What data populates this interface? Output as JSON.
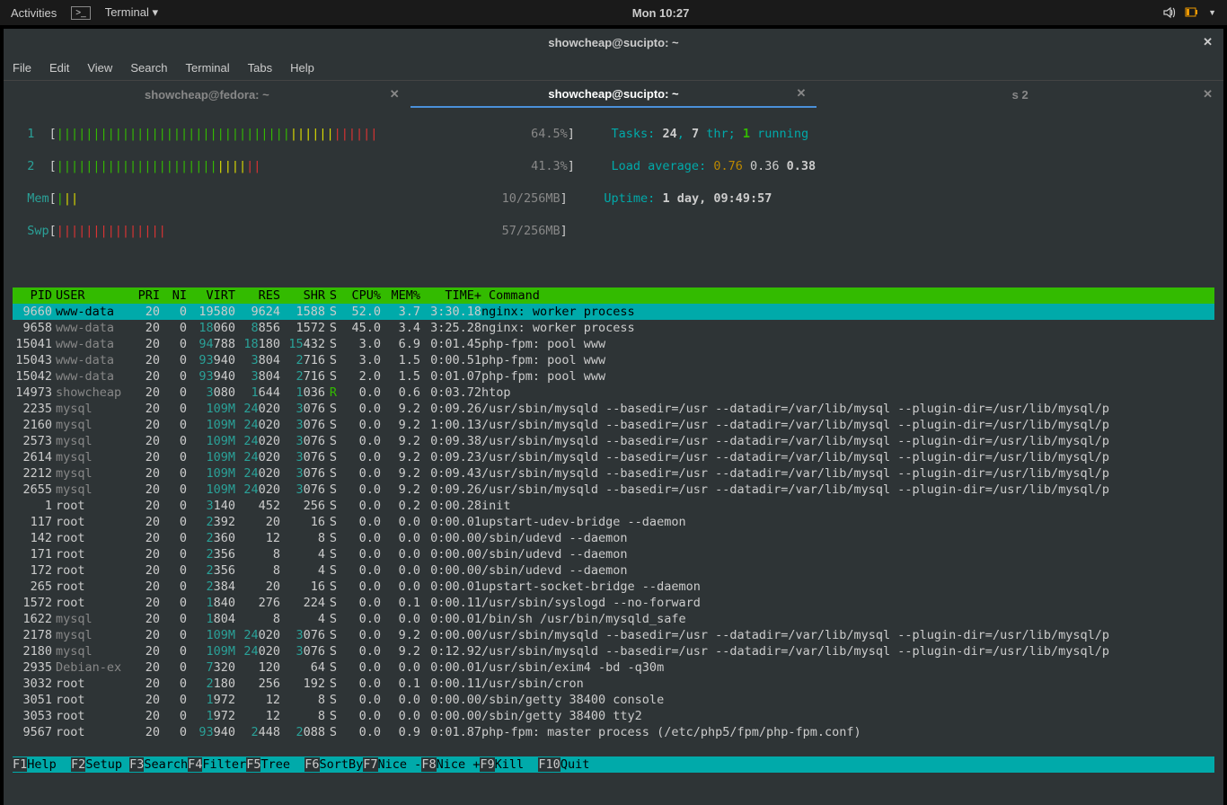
{
  "topbar": {
    "activities": "Activities",
    "terminal": "Terminal ▾",
    "clock": "Mon 10:27"
  },
  "titlebar": {
    "title": "showcheap@sucipto: ~"
  },
  "menubar": [
    "File",
    "Edit",
    "View",
    "Search",
    "Terminal",
    "Tabs",
    "Help"
  ],
  "tabs": [
    {
      "label": "showcheap@fedora: ~",
      "active": false
    },
    {
      "label": "showcheap@sucipto: ~",
      "active": true
    },
    {
      "label": "s                          2",
      "active": false
    }
  ],
  "meters": {
    "cpu1": {
      "label": "1",
      "pct": "64.5%"
    },
    "cpu2": {
      "label": "2",
      "pct": "41.3%"
    },
    "mem": {
      "label": "Mem",
      "val": "10/256MB"
    },
    "swp": {
      "label": "Swp",
      "val": "57/256MB"
    }
  },
  "stats": {
    "tasks_label": "Tasks: ",
    "tasks_n": "24",
    "tasks_comma": ", ",
    "thr_n": "7",
    "thr": " thr; ",
    "running_n": "1",
    "running": " running",
    "load_label": "Load average: ",
    "load1": "0.76",
    "load2": "0.36",
    "load3": "0.38",
    "uptime_label": "Uptime: ",
    "uptime": "1 day, 09:49:57"
  },
  "header": [
    "PID",
    "USER",
    "PRI",
    "NI",
    "VIRT",
    "RES",
    "SHR",
    "S",
    "CPU%",
    "MEM%",
    "TIME+",
    "Command"
  ],
  "processes": [
    {
      "pid": "9660",
      "user": "www-data",
      "pri": "20",
      "ni": "0",
      "virt": "19580",
      "res": "9624",
      "shr": "1588",
      "s": "S",
      "cpu": "52.0",
      "mem": "3.7",
      "time": "3:30.18",
      "cmd": "nginx: worker process",
      "sel": true
    },
    {
      "pid": "9658",
      "user": "www-data",
      "pri": "20",
      "ni": "0",
      "virt": "18060",
      "vh": "18",
      "res": "8856",
      "rh": "8",
      "shr": "1572",
      "s": "S",
      "cpu": "45.0",
      "mem": "3.4",
      "time": "3:25.28",
      "cmd": "nginx: worker process"
    },
    {
      "pid": "15041",
      "user": "www-data",
      "pri": "20",
      "ni": "0",
      "virt": "94788",
      "vh": "94",
      "res": "18180",
      "rh": "18",
      "shr": "15432",
      "sh": "15",
      "s": "S",
      "cpu": "3.0",
      "mem": "6.9",
      "time": "0:01.45",
      "cmd": "php-fpm: pool www"
    },
    {
      "pid": "15043",
      "user": "www-data",
      "pri": "20",
      "ni": "0",
      "virt": "93940",
      "vh": "93",
      "res": "3804",
      "rh": "3",
      "shr": "2716",
      "sh": "2",
      "s": "S",
      "cpu": "3.0",
      "mem": "1.5",
      "time": "0:00.51",
      "cmd": "php-fpm: pool www"
    },
    {
      "pid": "15042",
      "user": "www-data",
      "pri": "20",
      "ni": "0",
      "virt": "93940",
      "vh": "93",
      "res": "3804",
      "rh": "3",
      "shr": "2716",
      "sh": "2",
      "s": "S",
      "cpu": "2.0",
      "mem": "1.5",
      "time": "0:01.07",
      "cmd": "php-fpm: pool www"
    },
    {
      "pid": "14973",
      "user": "showcheap",
      "pri": "20",
      "ni": "0",
      "virt": "3080",
      "vh": "3",
      "res": "1644",
      "rh": "1",
      "shr": "1036",
      "sh": "1",
      "s": "R",
      "sR": true,
      "cpu": "0.0",
      "mem": "0.6",
      "time": "0:03.72",
      "cmd": "htop"
    },
    {
      "pid": "2235",
      "user": "mysql",
      "pri": "20",
      "ni": "0",
      "virt": "109M",
      "vh": "109M",
      "res": "24020",
      "rh": "24",
      "shr": "3076",
      "sh": "3",
      "s": "S",
      "cpu": "0.0",
      "mem": "9.2",
      "time": "0:09.26",
      "cmd": "/usr/sbin/mysqld --basedir=/usr --datadir=/var/lib/mysql --plugin-dir=/usr/lib/mysql/p"
    },
    {
      "pid": "2160",
      "user": "mysql",
      "pri": "20",
      "ni": "0",
      "virt": "109M",
      "vh": "109M",
      "res": "24020",
      "rh": "24",
      "shr": "3076",
      "sh": "3",
      "s": "S",
      "cpu": "0.0",
      "mem": "9.2",
      "time": "1:00.13",
      "cmd": "/usr/sbin/mysqld --basedir=/usr --datadir=/var/lib/mysql --plugin-dir=/usr/lib/mysql/p"
    },
    {
      "pid": "2573",
      "user": "mysql",
      "pri": "20",
      "ni": "0",
      "virt": "109M",
      "vh": "109M",
      "res": "24020",
      "rh": "24",
      "shr": "3076",
      "sh": "3",
      "s": "S",
      "cpu": "0.0",
      "mem": "9.2",
      "time": "0:09.38",
      "cmd": "/usr/sbin/mysqld --basedir=/usr --datadir=/var/lib/mysql --plugin-dir=/usr/lib/mysql/p"
    },
    {
      "pid": "2614",
      "user": "mysql",
      "pri": "20",
      "ni": "0",
      "virt": "109M",
      "vh": "109M",
      "res": "24020",
      "rh": "24",
      "shr": "3076",
      "sh": "3",
      "s": "S",
      "cpu": "0.0",
      "mem": "9.2",
      "time": "0:09.23",
      "cmd": "/usr/sbin/mysqld --basedir=/usr --datadir=/var/lib/mysql --plugin-dir=/usr/lib/mysql/p"
    },
    {
      "pid": "2212",
      "user": "mysql",
      "pri": "20",
      "ni": "0",
      "virt": "109M",
      "vh": "109M",
      "res": "24020",
      "rh": "24",
      "shr": "3076",
      "sh": "3",
      "s": "S",
      "cpu": "0.0",
      "mem": "9.2",
      "time": "0:09.43",
      "cmd": "/usr/sbin/mysqld --basedir=/usr --datadir=/var/lib/mysql --plugin-dir=/usr/lib/mysql/p"
    },
    {
      "pid": "2655",
      "user": "mysql",
      "pri": "20",
      "ni": "0",
      "virt": "109M",
      "vh": "109M",
      "res": "24020",
      "rh": "24",
      "shr": "3076",
      "sh": "3",
      "s": "S",
      "cpu": "0.0",
      "mem": "9.2",
      "time": "0:09.26",
      "cmd": "/usr/sbin/mysqld --basedir=/usr --datadir=/var/lib/mysql --plugin-dir=/usr/lib/mysql/p"
    },
    {
      "pid": "1",
      "user": "root",
      "pri": "20",
      "ni": "0",
      "virt": "3140",
      "vh": "3",
      "res": "452",
      "shr": "256",
      "s": "S",
      "cpu": "0.0",
      "mem": "0.2",
      "time": "0:00.28",
      "cmd": "init"
    },
    {
      "pid": "117",
      "user": "root",
      "pri": "20",
      "ni": "0",
      "virt": "2392",
      "vh": "2",
      "res": "20",
      "shr": "16",
      "s": "S",
      "cpu": "0.0",
      "mem": "0.0",
      "time": "0:00.01",
      "cmd": "upstart-udev-bridge --daemon"
    },
    {
      "pid": "142",
      "user": "root",
      "pri": "20",
      "ni": "0",
      "virt": "2360",
      "vh": "2",
      "res": "12",
      "shr": "8",
      "s": "S",
      "cpu": "0.0",
      "mem": "0.0",
      "time": "0:00.00",
      "cmd": "/sbin/udevd --daemon"
    },
    {
      "pid": "171",
      "user": "root",
      "pri": "20",
      "ni": "0",
      "virt": "2356",
      "vh": "2",
      "res": "8",
      "shr": "4",
      "s": "S",
      "cpu": "0.0",
      "mem": "0.0",
      "time": "0:00.00",
      "cmd": "/sbin/udevd --daemon"
    },
    {
      "pid": "172",
      "user": "root",
      "pri": "20",
      "ni": "0",
      "virt": "2356",
      "vh": "2",
      "res": "8",
      "shr": "4",
      "s": "S",
      "cpu": "0.0",
      "mem": "0.0",
      "time": "0:00.00",
      "cmd": "/sbin/udevd --daemon"
    },
    {
      "pid": "265",
      "user": "root",
      "pri": "20",
      "ni": "0",
      "virt": "2384",
      "vh": "2",
      "res": "20",
      "shr": "16",
      "s": "S",
      "cpu": "0.0",
      "mem": "0.0",
      "time": "0:00.01",
      "cmd": "upstart-socket-bridge --daemon"
    },
    {
      "pid": "1572",
      "user": "root",
      "pri": "20",
      "ni": "0",
      "virt": "1840",
      "vh": "1",
      "res": "276",
      "shr": "224",
      "s": "S",
      "cpu": "0.0",
      "mem": "0.1",
      "time": "0:00.11",
      "cmd": "/usr/sbin/syslogd --no-forward"
    },
    {
      "pid": "1622",
      "user": "mysql",
      "pri": "20",
      "ni": "0",
      "virt": "1804",
      "vh": "1",
      "res": "8",
      "shr": "4",
      "s": "S",
      "cpu": "0.0",
      "mem": "0.0",
      "time": "0:00.01",
      "cmd": "/bin/sh /usr/bin/mysqld_safe"
    },
    {
      "pid": "2178",
      "user": "mysql",
      "pri": "20",
      "ni": "0",
      "virt": "109M",
      "vh": "109M",
      "res": "24020",
      "rh": "24",
      "shr": "3076",
      "sh": "3",
      "s": "S",
      "cpu": "0.0",
      "mem": "9.2",
      "time": "0:00.00",
      "cmd": "/usr/sbin/mysqld --basedir=/usr --datadir=/var/lib/mysql --plugin-dir=/usr/lib/mysql/p"
    },
    {
      "pid": "2180",
      "user": "mysql",
      "pri": "20",
      "ni": "0",
      "virt": "109M",
      "vh": "109M",
      "res": "24020",
      "rh": "24",
      "shr": "3076",
      "sh": "3",
      "s": "S",
      "cpu": "0.0",
      "mem": "9.2",
      "time": "0:12.92",
      "cmd": "/usr/sbin/mysqld --basedir=/usr --datadir=/var/lib/mysql --plugin-dir=/usr/lib/mysql/p"
    },
    {
      "pid": "2935",
      "user": "Debian-ex",
      "pri": "20",
      "ni": "0",
      "virt": "7320",
      "vh": "7",
      "res": "120",
      "shr": "64",
      "s": "S",
      "cpu": "0.0",
      "mem": "0.0",
      "time": "0:00.01",
      "cmd": "/usr/sbin/exim4 -bd -q30m"
    },
    {
      "pid": "3032",
      "user": "root",
      "pri": "20",
      "ni": "0",
      "virt": "2180",
      "vh": "2",
      "res": "256",
      "shr": "192",
      "s": "S",
      "cpu": "0.0",
      "mem": "0.1",
      "time": "0:00.11",
      "cmd": "/usr/sbin/cron"
    },
    {
      "pid": "3051",
      "user": "root",
      "pri": "20",
      "ni": "0",
      "virt": "1972",
      "vh": "1",
      "res": "12",
      "shr": "8",
      "s": "S",
      "cpu": "0.0",
      "mem": "0.0",
      "time": "0:00.00",
      "cmd": "/sbin/getty 38400 console"
    },
    {
      "pid": "3053",
      "user": "root",
      "pri": "20",
      "ni": "0",
      "virt": "1972",
      "vh": "1",
      "res": "12",
      "shr": "8",
      "s": "S",
      "cpu": "0.0",
      "mem": "0.0",
      "time": "0:00.00",
      "cmd": "/sbin/getty 38400 tty2"
    },
    {
      "pid": "9567",
      "user": "root",
      "pri": "20",
      "ni": "0",
      "virt": "93940",
      "vh": "93",
      "res": "2448",
      "rh": "2",
      "shr": "2088",
      "sh": "2",
      "s": "S",
      "cpu": "0.0",
      "mem": "0.9",
      "time": "0:01.87",
      "cmd": "php-fpm: master process (/etc/php5/fpm/php-fpm.conf)"
    }
  ],
  "fkeys": [
    [
      "F1",
      "Help"
    ],
    [
      "F2",
      "Setup"
    ],
    [
      "F3",
      "Search"
    ],
    [
      "F4",
      "Filter"
    ],
    [
      "F5",
      "Tree"
    ],
    [
      "F6",
      "SortBy"
    ],
    [
      "F7",
      "Nice -"
    ],
    [
      "F8",
      "Nice +"
    ],
    [
      "F9",
      "Kill"
    ],
    [
      "F10",
      "Quit"
    ]
  ]
}
